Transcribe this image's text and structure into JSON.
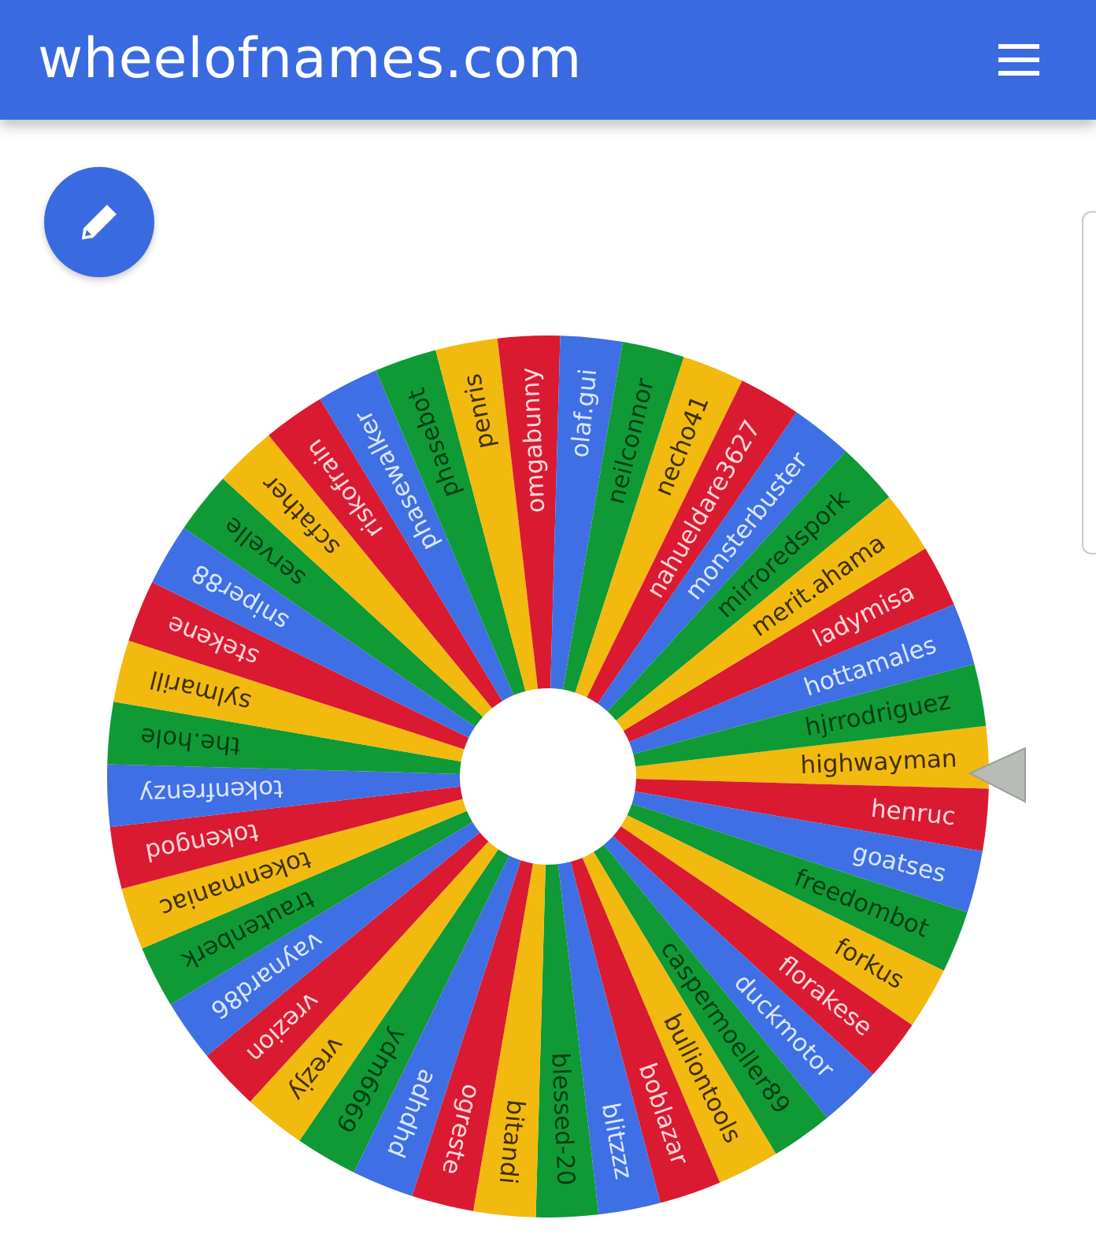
{
  "header": {
    "title": "wheelofnames.com"
  },
  "wheel": {
    "segments": [
      {
        "name": "highwayman"
      },
      {
        "name": "henruc"
      },
      {
        "name": "goatses"
      },
      {
        "name": "freedombot"
      },
      {
        "name": "forkus"
      },
      {
        "name": "florakese"
      },
      {
        "name": "duckmotor"
      },
      {
        "name": "caspermoeller89"
      },
      {
        "name": "bulliontools"
      },
      {
        "name": "boblazar"
      },
      {
        "name": "blitzzz"
      },
      {
        "name": "blessed-20"
      },
      {
        "name": "bitandi"
      },
      {
        "name": "ogreste"
      },
      {
        "name": "adhdhd"
      },
      {
        "name": "ydm6669"
      },
      {
        "name": "vrezjy"
      },
      {
        "name": "vrezion"
      },
      {
        "name": "vaynard86"
      },
      {
        "name": "trautenberk"
      },
      {
        "name": "tokenmaniac"
      },
      {
        "name": "tokengod"
      },
      {
        "name": "tokenfrenzy"
      },
      {
        "name": "the.hole"
      },
      {
        "name": "sylmarill"
      },
      {
        "name": "stekene"
      },
      {
        "name": "sniper88"
      },
      {
        "name": "servelle"
      },
      {
        "name": "scfather"
      },
      {
        "name": "riskofrain"
      },
      {
        "name": "phasewalker"
      },
      {
        "name": "phasebot"
      },
      {
        "name": "penris"
      },
      {
        "name": "omgabunny"
      },
      {
        "name": "olaf.gui"
      },
      {
        "name": "neilconnor"
      },
      {
        "name": "necho41"
      },
      {
        "name": "nahueldare3627"
      },
      {
        "name": "monsterbuster"
      },
      {
        "name": "mirroredspork"
      },
      {
        "name": "merit.ahama"
      },
      {
        "name": "ladymisa"
      },
      {
        "name": "hottamales"
      },
      {
        "name": "hjrrodriguez"
      }
    ]
  }
}
